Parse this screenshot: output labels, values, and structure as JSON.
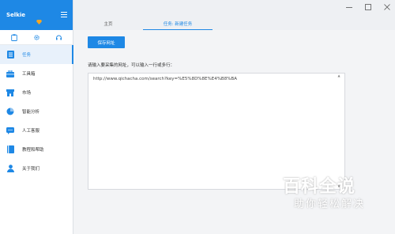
{
  "app": {
    "title": "Selkie"
  },
  "colors": {
    "accent": "#1e88e5",
    "badge": "#f5a623"
  },
  "sidebar": {
    "top_icons": [
      "clipboard-icon",
      "gear-icon",
      "headset-icon"
    ],
    "items": [
      {
        "label": "任务",
        "icon": "task-list-icon",
        "active": true
      },
      {
        "label": "工具箱",
        "icon": "toolbox-icon",
        "active": false
      },
      {
        "label": "市场",
        "icon": "market-icon",
        "active": false
      },
      {
        "label": "智能分析",
        "icon": "pie-chart-icon",
        "active": false
      },
      {
        "label": "人工客服",
        "icon": "chat-icon",
        "active": false
      },
      {
        "label": "教程和帮助",
        "icon": "book-icon",
        "active": false
      },
      {
        "label": "关于我们",
        "icon": "user-icon",
        "active": false
      }
    ]
  },
  "tabs": [
    {
      "label": "主页",
      "active": false
    },
    {
      "label": "任务: 新建任务",
      "active": true
    }
  ],
  "main": {
    "save_button": "保存网址",
    "hint": "请输入要采集的网址，可以输入一行或多行：",
    "url_value": "http://www.qichacha.com/search?key=%E5%8D%8E%E4%B8%BA"
  },
  "watermark": {
    "line1": "百科全说",
    "line2": "助你轻松解决"
  }
}
